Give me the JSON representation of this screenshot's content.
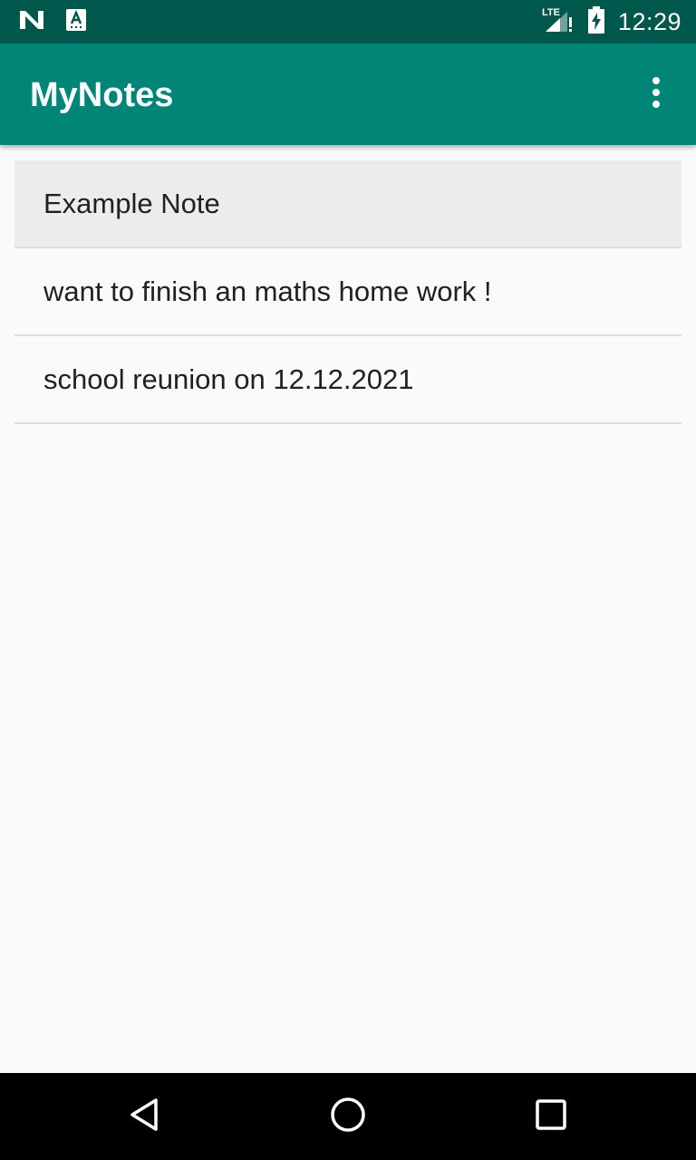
{
  "status_bar": {
    "time": "12:29",
    "icons": [
      "n-logo-icon",
      "a-keyboard-icon",
      "lte-signal-icon",
      "battery-charging-icon"
    ],
    "network_label": "LTE"
  },
  "app_bar": {
    "title": "MyNotes",
    "overflow_icon": "more-vert-icon"
  },
  "notes": [
    {
      "text": "Example Note"
    },
    {
      "text": "want to finish an maths home work !"
    },
    {
      "text": "school reunion on 12.12.2021"
    }
  ],
  "nav_bar": {
    "icons": [
      "back-icon",
      "home-icon",
      "recents-icon"
    ]
  },
  "colors": {
    "status_bar": "#00574b",
    "app_bar": "#008577",
    "background": "#fafafa",
    "selected_item": "#ececec"
  }
}
